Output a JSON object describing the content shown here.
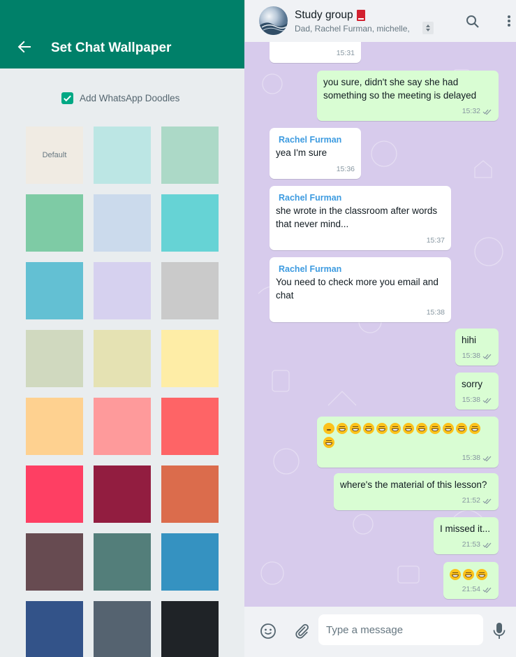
{
  "wallpaper_panel": {
    "title": "Set Chat Wallpaper",
    "doodles": {
      "label": "Add WhatsApp Doodles",
      "checked": true
    },
    "swatches": [
      {
        "label": "Default",
        "color": "#f0ebe3"
      },
      {
        "color": "#bce6e4"
      },
      {
        "color": "#acd9c7"
      },
      {
        "color": "#7ecba5"
      },
      {
        "color": "#cbdaec"
      },
      {
        "color": "#66d3d5"
      },
      {
        "color": "#63c0d3"
      },
      {
        "color": "#d6d1ef"
      },
      {
        "color": "#cacaca"
      },
      {
        "color": "#d0d9bf"
      },
      {
        "color": "#e5e2b3"
      },
      {
        "color": "#feeda6"
      },
      {
        "color": "#fed190"
      },
      {
        "color": "#fe9a9b"
      },
      {
        "color": "#fe6466"
      },
      {
        "color": "#fe3f63"
      },
      {
        "color": "#921d40"
      },
      {
        "color": "#db6c4c"
      },
      {
        "color": "#674b51"
      },
      {
        "color": "#537e7a"
      },
      {
        "color": "#3592c1"
      },
      {
        "color": "#335389"
      },
      {
        "color": "#556370"
      },
      {
        "color": "#1f2327"
      }
    ]
  },
  "chat": {
    "group_name": "Study group",
    "members": "Dad, Rachel Furman, michelle,",
    "background_color": "#d7cbec",
    "messages": [
      {
        "direction": "in",
        "sender": "",
        "text": "",
        "time": "15:31"
      },
      {
        "direction": "out",
        "text": "you sure, didn't she say she had something so the meeting is delayed",
        "time": "15:32",
        "read": true
      },
      {
        "direction": "in",
        "sender": "Rachel Furman",
        "text": "yea I'm sure",
        "time": "15:36"
      },
      {
        "direction": "in",
        "sender": "Rachel Furman",
        "text": "she wrote in the classroom after words that never mind...",
        "time": "15:37"
      },
      {
        "direction": "in",
        "sender": "Rachel Furman",
        "text": "You need to check more you email and chat",
        "time": "15:38"
      },
      {
        "direction": "out",
        "text": "hihi",
        "time": "15:38",
        "read": true
      },
      {
        "direction": "out",
        "text": "sorry",
        "time": "15:38",
        "read": true
      },
      {
        "direction": "out",
        "emoji": "😶😅😅😅😅😅😅😅😅😅😅😅😅",
        "time": "15:38",
        "read": true
      },
      {
        "direction": "out",
        "text": "where's the material of this lesson?",
        "time": "21:52",
        "read": true
      },
      {
        "direction": "out",
        "text": "I missed it...",
        "time": "21:53",
        "read": true
      },
      {
        "direction": "out",
        "emoji": "😅😅😅",
        "time": "21:54",
        "read": true
      }
    ]
  },
  "composer": {
    "placeholder": "Type a message"
  },
  "icons": {
    "back": "arrow-left-icon",
    "search": "search-icon",
    "menu": "menu-dots-icon",
    "emoji": "smiley-icon",
    "attach": "paperclip-icon",
    "mic": "mic-icon"
  },
  "colors": {
    "header_green": "#008069",
    "checkbox_green": "#00a884",
    "outgoing_bubble": "#d9fdd3",
    "sender_name": "#3d9be0",
    "read_ticks": "#8696a0"
  }
}
